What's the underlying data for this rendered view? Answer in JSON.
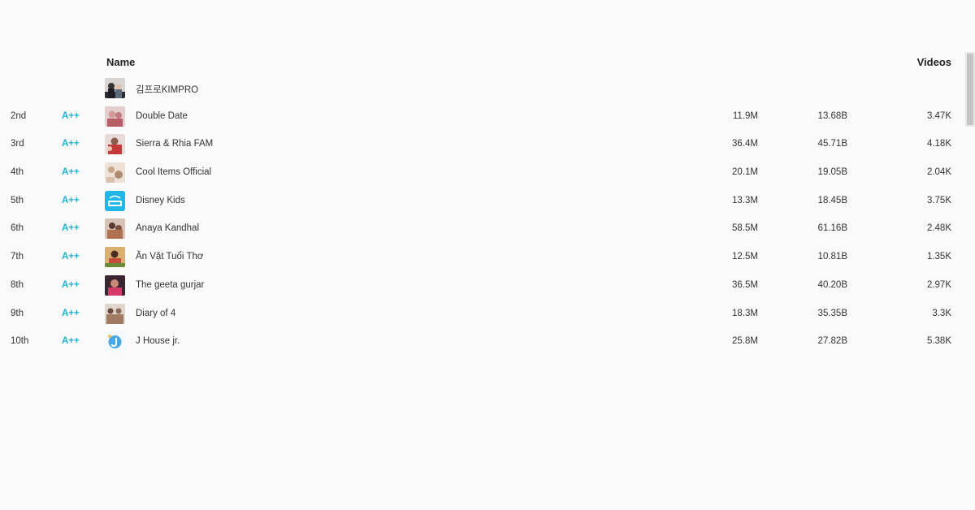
{
  "header": {
    "name_label": "Name",
    "videos_label": "Videos"
  },
  "rows": [
    {
      "rank": "",
      "grade": "",
      "name": "김프로KIMPRO",
      "subscribers": "",
      "views": "",
      "videos": "",
      "avatar_color": "#5a5a66"
    },
    {
      "rank": "2nd",
      "grade": "A++",
      "name": "Double Date",
      "subscribers": "11.9M",
      "views": "13.68B",
      "videos": "3.47K",
      "avatar_color": "#c9868c"
    },
    {
      "rank": "3rd",
      "grade": "A++",
      "name": "Sierra & Rhia FAM",
      "subscribers": "36.4M",
      "views": "45.71B",
      "videos": "4.18K",
      "avatar_color": "#b9524f"
    },
    {
      "rank": "4th",
      "grade": "A++",
      "name": "Cool Items Official",
      "subscribers": "20.1M",
      "views": "19.05B",
      "videos": "2.04K",
      "avatar_color": "#c8a996"
    },
    {
      "rank": "5th",
      "grade": "A++",
      "name": "Disney Kids",
      "subscribers": "13.3M",
      "views": "18.45B",
      "videos": "3.75K",
      "avatar_color": "#1fb4e6"
    },
    {
      "rank": "6th",
      "grade": "A++",
      "name": "Anaya Kandhal",
      "subscribers": "58.5M",
      "views": "61.16B",
      "videos": "2.48K",
      "avatar_color": "#a88670"
    },
    {
      "rank": "7th",
      "grade": "A++",
      "name": "Ăn Vặt Tuổi Thơ",
      "subscribers": "12.5M",
      "views": "10.81B",
      "videos": "1.35K",
      "avatar_color": "#b07a3c"
    },
    {
      "rank": "8th",
      "grade": "A++",
      "name": "The geeta gurjar",
      "subscribers": "36.5M",
      "views": "40.20B",
      "videos": "2.97K",
      "avatar_color": "#4a2a36"
    },
    {
      "rank": "9th",
      "grade": "A++",
      "name": "Diary of 4",
      "subscribers": "18.3M",
      "views": "35.35B",
      "videos": "3.3K",
      "avatar_color": "#9c8270"
    },
    {
      "rank": "10th",
      "grade": "A++",
      "name": "J House jr.",
      "subscribers": "25.8M",
      "views": "27.82B",
      "videos": "5.38K",
      "avatar_color": "#e8f3fb"
    }
  ]
}
